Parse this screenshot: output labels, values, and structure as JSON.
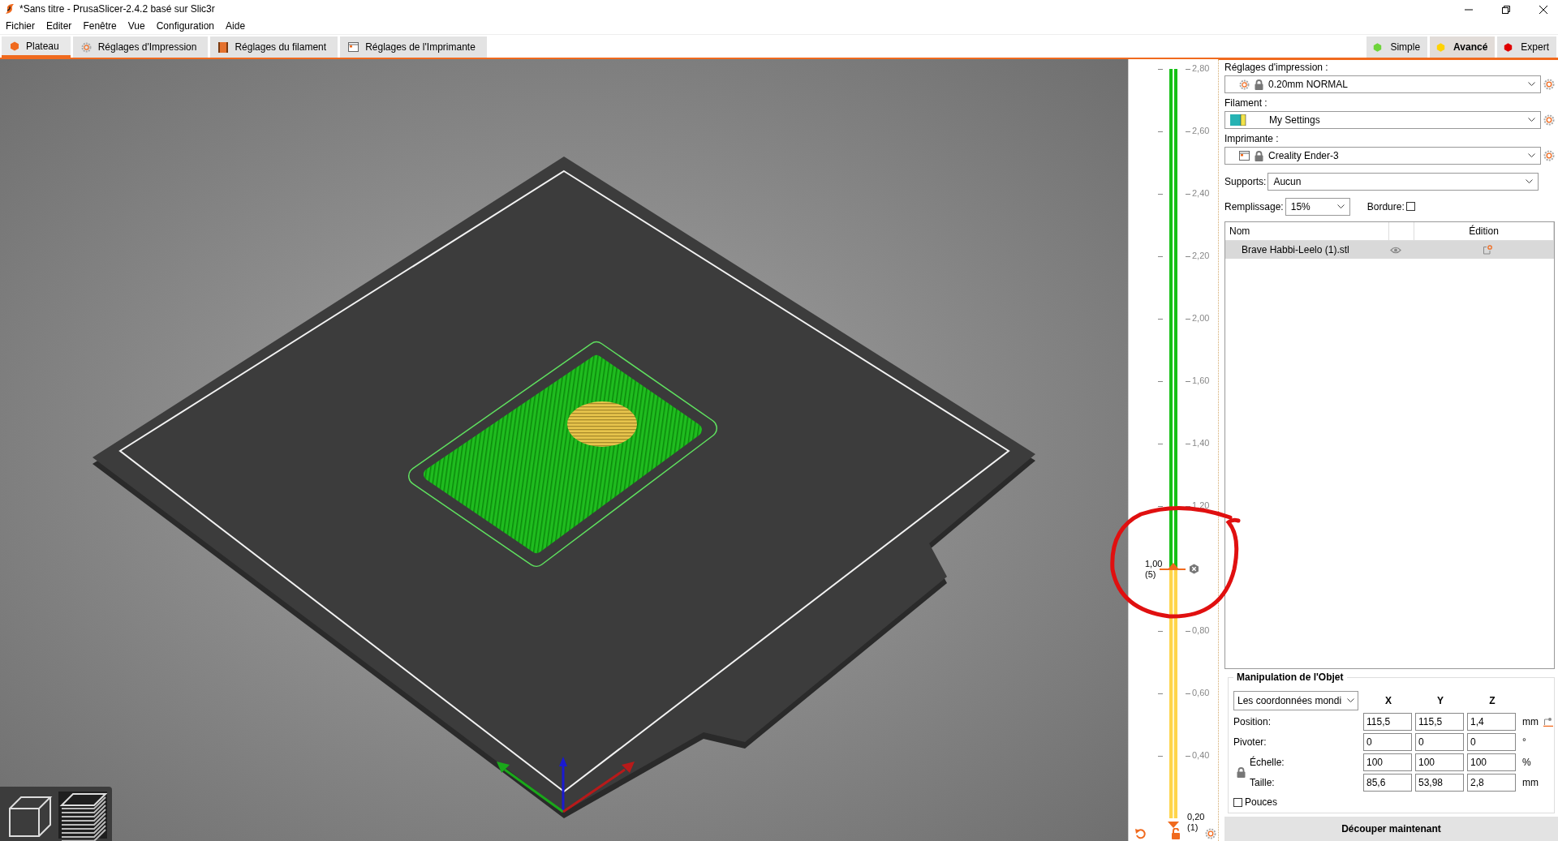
{
  "window": {
    "title": "*Sans titre - PrusaSlicer-2.4.2 basé sur Slic3r"
  },
  "menu": [
    "Fichier",
    "Editer",
    "Fenêtre",
    "Vue",
    "Configuration",
    "Aide"
  ],
  "tabs": [
    {
      "label": "Plateau",
      "selected": true,
      "kind": "plater"
    },
    {
      "label": "Réglages d'Impression",
      "selected": false,
      "kind": "print"
    },
    {
      "label": "Réglages du filament",
      "selected": false,
      "kind": "filament"
    },
    {
      "label": "Réglages de l'Imprimante",
      "selected": false,
      "kind": "printer"
    }
  ],
  "modes": [
    {
      "label": "Simple",
      "selected": false,
      "color": "#6ed43a"
    },
    {
      "label": "Avancé",
      "selected": true,
      "color": "#ffd200"
    },
    {
      "label": "Expert",
      "selected": false,
      "color": "#e00000"
    }
  ],
  "layer_slider": {
    "level": 0.333,
    "slots": [
      {
        "kind": "tick",
        "label": "2,80"
      },
      {
        "kind": "tick",
        "label": "2,60"
      },
      {
        "kind": "tick",
        "label": "2,40"
      },
      {
        "kind": "tick",
        "label": "2,20"
      },
      {
        "kind": "tick",
        "label": "2,00"
      },
      {
        "kind": "tick",
        "label": "1,60"
      },
      {
        "kind": "tick",
        "label": "1,40"
      },
      {
        "kind": "tick",
        "label": "1,20"
      },
      {
        "kind": "upper",
        "value": "1,00",
        "layer": "(5)"
      },
      {
        "kind": "tick",
        "label": "0,80"
      },
      {
        "kind": "tick",
        "label": "0,60"
      },
      {
        "kind": "tick",
        "label": "0,40"
      },
      {
        "kind": "lower",
        "value": "0,20",
        "layer": "(1)"
      }
    ]
  },
  "sidebar": {
    "presets": [
      {
        "label": "Réglages d'impression :",
        "value": "0.20mm NORMAL",
        "kind": "print"
      },
      {
        "label": "Filament :",
        "value": "My Settings",
        "kind": "filament"
      },
      {
        "label": "Imprimante :",
        "value": "Creality Ender-3",
        "kind": "printer"
      }
    ],
    "supports": {
      "label": "Supports:",
      "value": "Aucun"
    },
    "infill": {
      "label": "Remplissage:",
      "value": "15%"
    },
    "brim": {
      "label": "Bordure:",
      "checked": false
    },
    "object_list": {
      "columns": [
        "Nom",
        "Édition"
      ],
      "rows": [
        {
          "name": "Brave Habbi-Leelo (1).stl",
          "selected": true
        }
      ]
    },
    "manipulation": {
      "title": "Manipulation de l'Objet",
      "coordinates": "Les coordonnées mondi",
      "axes": [
        "X",
        "Y",
        "Z"
      ],
      "rows": [
        {
          "kind": "position",
          "label": "Position:",
          "values": [
            "115,5",
            "115,5",
            "1,4"
          ],
          "unit": "mm"
        },
        {
          "kind": "rotation",
          "label": "Pivoter:",
          "values": [
            "0",
            "0",
            "0"
          ],
          "unit": "°"
        },
        {
          "kind": "scale",
          "label": "Échelle:",
          "values": [
            "100",
            "100",
            "100"
          ],
          "unit": "%"
        },
        {
          "kind": "size",
          "label": "Taille:",
          "values": [
            "85,6",
            "53,98",
            "2,8"
          ],
          "unit": "mm"
        }
      ],
      "inches": {
        "label": "Pouces",
        "checked": false
      }
    },
    "slice_button": "Découper maintenant"
  }
}
